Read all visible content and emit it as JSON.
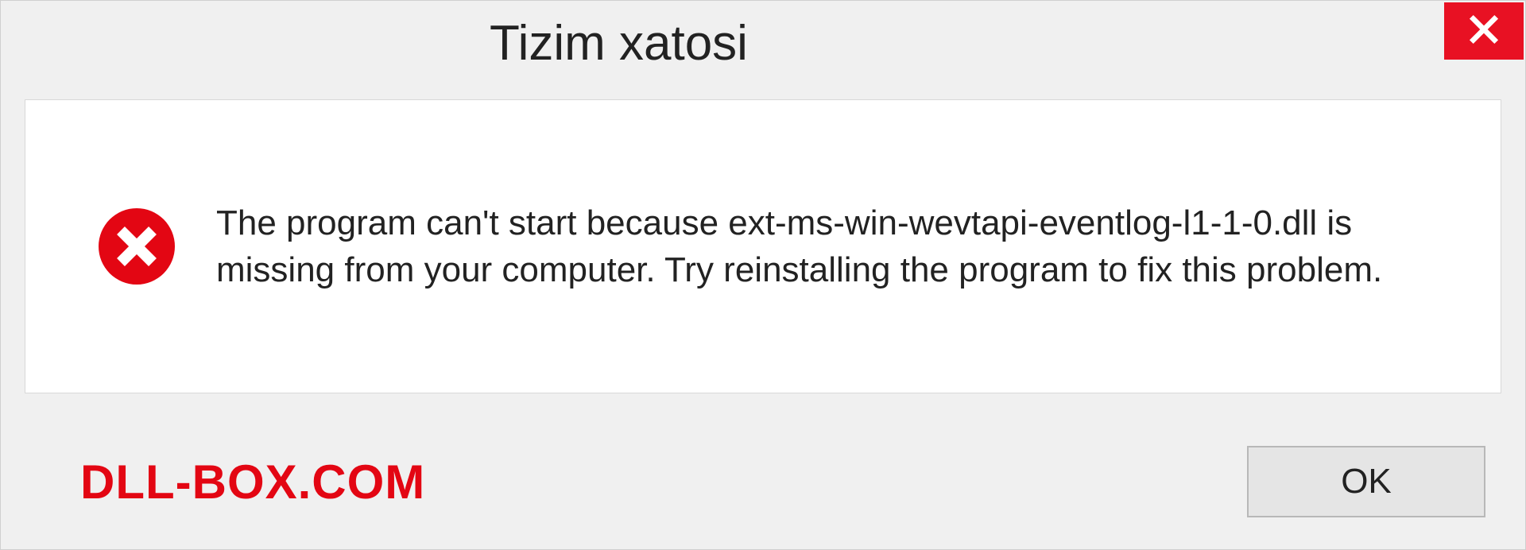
{
  "dialog": {
    "title": "Tizim xatosi",
    "message": "The program can't start because ext-ms-win-wevtapi-eventlog-l1-1-0.dll is missing from your computer. Try reinstalling the program to fix this problem.",
    "ok_label": "OK",
    "watermark": "DLL-BOX.COM"
  }
}
